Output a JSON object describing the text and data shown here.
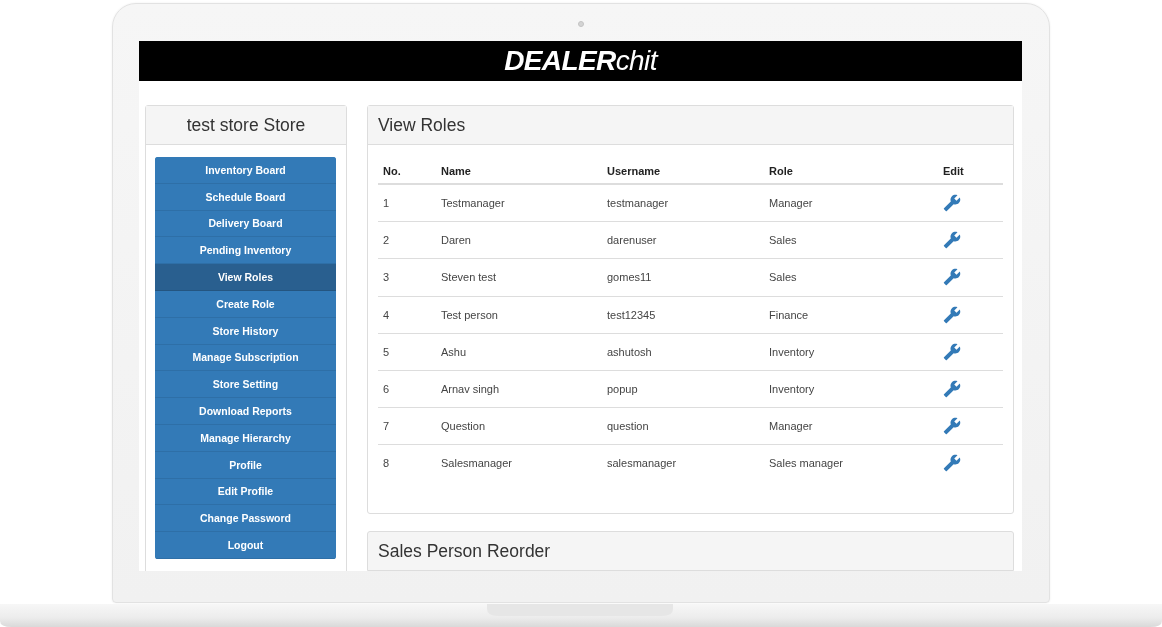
{
  "brand": {
    "logo": "**DEALER**chit"
  },
  "sidebar": {
    "title": "test store Store",
    "items": [
      {
        "label": "Inventory Board",
        "selected": false
      },
      {
        "label": "Schedule Board",
        "selected": false
      },
      {
        "label": "Delivery Board",
        "selected": false
      },
      {
        "label": "Pending Inventory",
        "selected": false
      },
      {
        "label": "View Roles",
        "selected": true
      },
      {
        "label": "Create Role",
        "selected": false
      },
      {
        "label": "Store History",
        "selected": false
      },
      {
        "label": "Manage Subscription",
        "selected": false
      },
      {
        "label": "Store Setting",
        "selected": false
      },
      {
        "label": "Download Reports",
        "selected": false
      },
      {
        "label": "Manage Hierarchy",
        "selected": false
      },
      {
        "label": "Profile",
        "selected": false
      },
      {
        "label": "Edit Profile",
        "selected": false
      },
      {
        "label": "Change Password",
        "selected": false
      },
      {
        "label": "Logout",
        "selected": false
      }
    ]
  },
  "roles_panel": {
    "title": "View Roles",
    "columns": [
      "No.",
      "Name",
      "Username",
      "Role",
      "Edit"
    ],
    "rows": [
      {
        "cells": [
          "1",
          "Testmanager",
          "testmanager",
          "Manager"
        ]
      },
      {
        "cells": [
          "2",
          "Daren",
          "darenuser",
          "Sales"
        ]
      },
      {
        "cells": [
          "3",
          "Steven test",
          "gomes11",
          "Sales"
        ]
      },
      {
        "cells": [
          "4",
          "Test person",
          "test12345",
          "Finance"
        ]
      },
      {
        "cells": [
          "5",
          "Ashu",
          "ashutosh",
          "Inventory"
        ]
      },
      {
        "cells": [
          "6",
          "Arnav singh",
          "popup",
          "Inventory"
        ]
      },
      {
        "cells": [
          "7",
          "Question",
          "question",
          "Manager"
        ]
      },
      {
        "cells": [
          "8",
          "Salesmanager",
          "salesmanager",
          "Sales manager"
        ]
      }
    ]
  },
  "reorder_panel": {
    "title": "Sales Person Reorder"
  }
}
